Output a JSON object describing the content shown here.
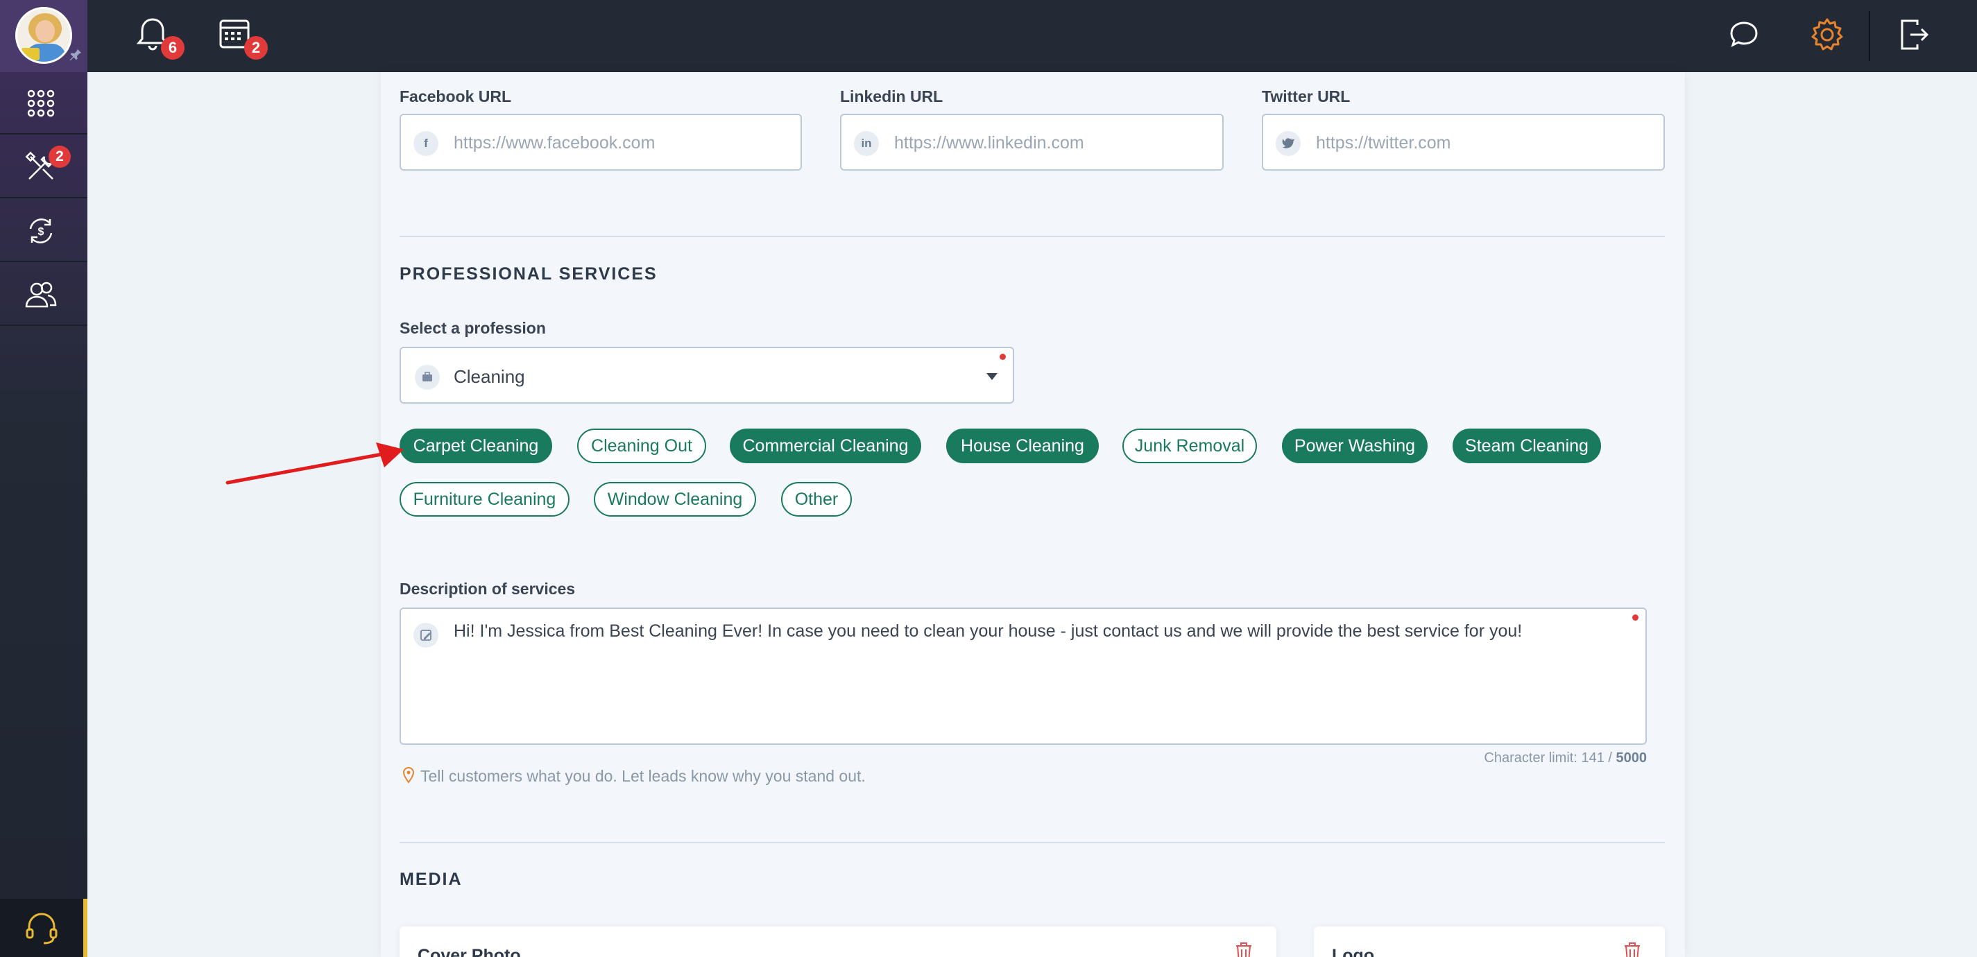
{
  "topbar": {
    "notifications_count": "6",
    "calendar_count": "2"
  },
  "sidebar": {
    "tools_badge": "2"
  },
  "social": {
    "facebook": {
      "label": "Facebook URL",
      "placeholder": "https://www.facebook.com",
      "icon_text": "f"
    },
    "linkedin": {
      "label": "Linkedin URL",
      "placeholder": "https://www.linkedin.com",
      "icon_text": "in"
    },
    "twitter": {
      "label": "Twitter URL",
      "placeholder": "https://twitter.com"
    }
  },
  "professional": {
    "title": "PROFESSIONAL SERVICES",
    "select_label": "Select a profession",
    "selected": "Cleaning",
    "chips": [
      {
        "label": "Carpet Cleaning",
        "selected": true
      },
      {
        "label": "Cleaning Out",
        "selected": false
      },
      {
        "label": "Commercial Cleaning",
        "selected": true
      },
      {
        "label": "House Cleaning",
        "selected": true
      },
      {
        "label": "Junk Removal",
        "selected": false
      },
      {
        "label": "Power Washing",
        "selected": true
      },
      {
        "label": "Steam Cleaning",
        "selected": true
      },
      {
        "label": "Furniture Cleaning",
        "selected": false
      },
      {
        "label": "Window Cleaning",
        "selected": false
      },
      {
        "label": "Other",
        "selected": false
      }
    ],
    "description_label": "Description of services",
    "description": "Hi! I'm Jessica from Best Cleaning Ever! In case you need to clean your house - just contact us and we will provide the best service for you!",
    "char_limit_prefix": "Character limit: 141 / ",
    "char_limit_max": "5000",
    "hint": "Tell customers what you do. Let leads know why you stand out."
  },
  "media": {
    "title": "MEDIA",
    "cover_label": "Cover Photo",
    "logo_label": "Logo"
  },
  "colors": {
    "accent_green": "#1a7a5e",
    "topbar": "#232a36",
    "badge_red": "#e03a3a",
    "gear_orange": "#e8852c"
  }
}
